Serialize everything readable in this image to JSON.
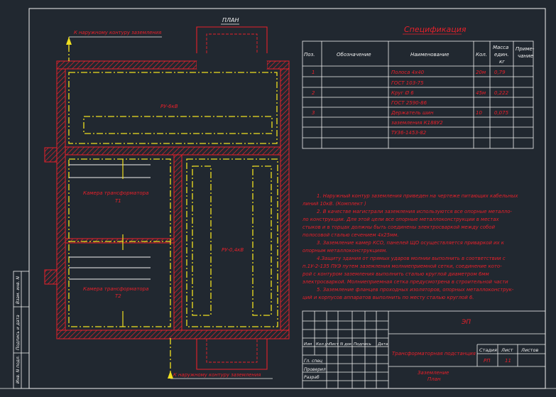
{
  "plan": {
    "title": "ПЛАН",
    "arrow_top": "К наружному контуру заземления",
    "arrow_bottom": "К наружному контуру заземления",
    "room_ru6": "РУ-6кВ",
    "room_t1_line1": "Камера трансформатора",
    "room_t1_line2": "Т1",
    "room_t2_line1": "Камера трансформатора",
    "room_t2_line2": "Т2",
    "room_ru04": "РУ-0,4кВ"
  },
  "spec": {
    "title": "Спецификация",
    "headers": {
      "pos": "Поз.",
      "designation": "Обозначение",
      "name": "Наименование",
      "qty": "Кол.",
      "mass_1": "Масса",
      "mass_2": "един.",
      "mass_3": "кг",
      "note_1": "Приме-",
      "note_2": "чание"
    },
    "rows": [
      {
        "pos": "1",
        "name": "Полоса 4х40",
        "qty": "20м",
        "mass": "0,79"
      },
      {
        "pos": "",
        "name": "ГОСТ 103-75",
        "qty": "",
        "mass": ""
      },
      {
        "pos": "2",
        "name": "Круг Ø 6",
        "qty": "45м",
        "mass": "0,222"
      },
      {
        "pos": "",
        "name": "ГОСТ 2590-86",
        "qty": "",
        "mass": ""
      },
      {
        "pos": "3",
        "name": "Держатель шин",
        "qty": "10",
        "mass": "0,075"
      },
      {
        "pos": "",
        "name": "заземления К188У2",
        "qty": "",
        "mass": ""
      },
      {
        "pos": "",
        "name": "ТУ36-1453-82",
        "qty": "",
        "mass": ""
      }
    ]
  },
  "notes": {
    "line1": "1. Наружный контур заземления приведен на чертеже питающих кабельных",
    "line2": "линий 10кВ. (Комплект )",
    "line3": "2. В качестве магистрали заземления используются все опорные металло-",
    "line4": "ло конструкции. Для этой цели все опорные металлоконструкции в местах",
    "line5": "стыков и в торцах должны быть соединены электросваркой между собой",
    "line6": "полосовой сталью сечением 4х25мм.",
    "line7": "3. Заземление камер КСО, панелей ЩО осуществляется приваркой их к",
    "line8": "опорным металлоконструкциям.",
    "line9": "4.Защиту здания от прямых ударов молнии выполнить в соответствии с",
    "line10": "п.1У-2-135 ПУЭ путем заземления молниеприемной сетки, соединение кото-",
    "line11": "рой с контуром заземления выполнить сталью круглой диаметром 6мм",
    "line12": "электросваркой. Молниеприемная сетка предусмотрена в строительной части",
    "line13": "5. Заземление фланцев проходных изоляторов, опорных металлоконструк-",
    "line14": "ций и корпусов аппаратов выполнить по месту сталью круглой 6."
  },
  "titleblock": {
    "code": "ЭП",
    "cols": {
      "izm": "Изм",
      "kol": "Кол.уч",
      "list": "Лист",
      "ndok": "N док",
      "podp": "Подпись",
      "data": "Дата"
    },
    "rows": {
      "gip": "Гл. спец",
      "prov": "Проверил",
      "razr": "Разраб"
    },
    "project": "Трансформаторная подстанция",
    "sheet_title_1": "Заземление",
    "sheet_title_2": "План",
    "stage_label": "Стадия",
    "sheet_label": "Лист",
    "sheets_label": "Листов",
    "stage": "РП",
    "sheet": "11"
  },
  "side_stamp": {
    "inv": "Инв. N подл.",
    "podp": "Подпись и дата",
    "vzam": "Взам. инв. N"
  },
  "colors": {
    "background": "#212830",
    "wall": "#e8202a",
    "axis": "#f0e020",
    "frame": "#f2f2f2"
  }
}
